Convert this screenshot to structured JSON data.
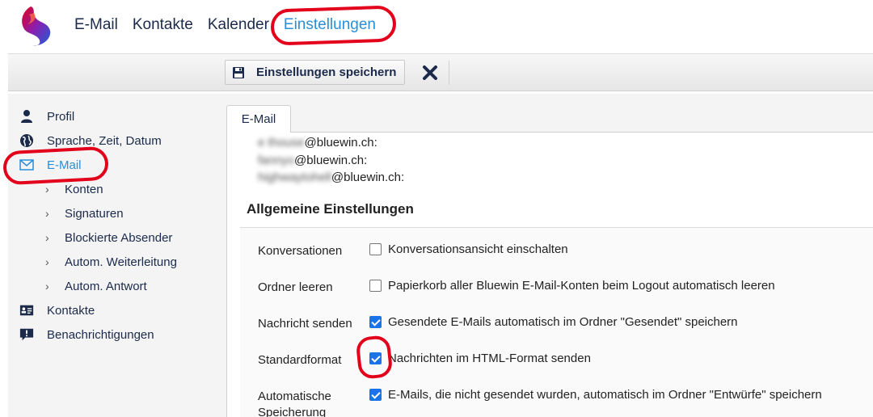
{
  "header": {
    "logo": "swisscom-logo",
    "nav": [
      {
        "label": "E-Mail",
        "active": false
      },
      {
        "label": "Kontakte",
        "active": false
      },
      {
        "label": "Kalender",
        "active": false
      },
      {
        "label": "Einstellungen",
        "active": true
      }
    ]
  },
  "toolbar": {
    "save_label": "Einstellungen speichern",
    "save_icon": "floppy-disk-icon",
    "close_icon": "close-x-icon"
  },
  "sidebar": {
    "items": [
      {
        "label": "Profil",
        "icon": "person-icon"
      },
      {
        "label": "Sprache, Zeit, Datum",
        "icon": "globe-icon"
      },
      {
        "label": "E-Mail",
        "icon": "envelope-icon",
        "active": true
      },
      {
        "label": "Konten",
        "sub": true
      },
      {
        "label": "Signaturen",
        "sub": true
      },
      {
        "label": "Blockierte Absender",
        "sub": true
      },
      {
        "label": "Autom. Weiterleitung",
        "sub": true
      },
      {
        "label": "Autom. Antwort",
        "sub": true
      },
      {
        "label": "Kontakte",
        "icon": "contact-card-icon"
      },
      {
        "label": "Benachrichtigungen",
        "icon": "notification-icon"
      }
    ]
  },
  "main": {
    "tab_label": "E-Mail",
    "addresses": [
      {
        "redacted": "e thouse",
        "domain": "@bluewin.ch:"
      },
      {
        "redacted": "fannyo",
        "domain": "@bluewin.ch:"
      },
      {
        "redacted": "highwaytohell",
        "domain": "@bluewin.ch:"
      }
    ],
    "section_title": "Allgemeine Einstellungen",
    "settings": [
      {
        "label": "Konversationen",
        "option": "Konversationsansicht einschalten",
        "checked": false
      },
      {
        "label": "Ordner leeren",
        "option": "Papierkorb aller Bluewin E-Mail-Konten beim Logout automatisch leeren",
        "checked": false
      },
      {
        "label": "Nachricht senden",
        "option": "Gesendete E-Mails automatisch im Ordner \"Gesendet\" speichern",
        "checked": true
      },
      {
        "label": "Standardformat",
        "option": "Nachrichten im HTML-Format senden",
        "checked": true
      },
      {
        "label": "Automatische Speicherung",
        "option": "E-Mails, die nicht gesendet wurden, automatisch im Ordner \"Entwürfe\" speichern",
        "checked": true
      }
    ]
  },
  "colors": {
    "accent": "#2a8fd6",
    "nav_text": "#1b2a4a",
    "checkbox_checked": "#1a73e8",
    "annotation_red": "#e3001b"
  }
}
